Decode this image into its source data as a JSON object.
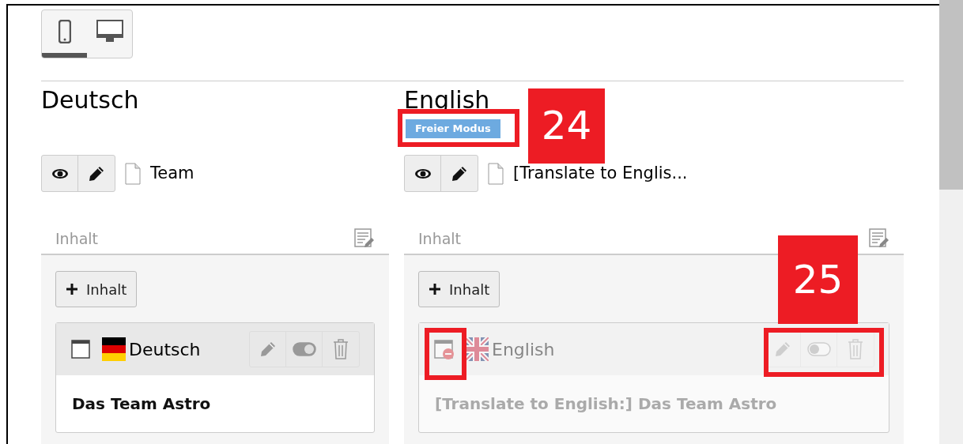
{
  "view_toggle": [
    {
      "kind": "mobile",
      "selected": true
    },
    {
      "kind": "desktop",
      "selected": false
    }
  ],
  "columns": [
    {
      "heading": "Deutsch",
      "page_title": "Team",
      "section_label": "Inhalt",
      "add_button": "Inhalt",
      "element": {
        "kind": "german-flag",
        "language": "Deutsch",
        "body": "Das Team Astro",
        "faded": false
      }
    },
    {
      "heading": "English",
      "badge": "Freier Modus",
      "page_title": "[Translate to Englis...",
      "section_label": "Inhalt",
      "add_button": "Inhalt",
      "element": {
        "kind": "uk-flag",
        "language": "English",
        "body": "[Translate to English:] Das Team Astro",
        "faded": true
      }
    }
  ],
  "annotations": [
    {
      "number": "24"
    },
    {
      "number": "25"
    }
  ]
}
